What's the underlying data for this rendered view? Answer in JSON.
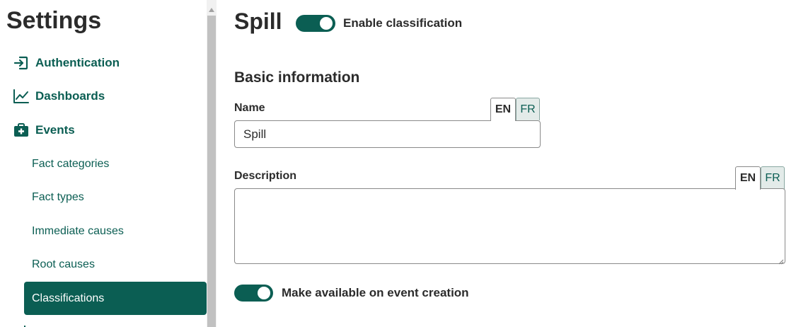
{
  "sidebar": {
    "title": "Settings",
    "main_items": [
      {
        "label": "Authentication",
        "icon": "sign-in-icon"
      },
      {
        "label": "Dashboards",
        "icon": "line-chart-icon"
      },
      {
        "label": "Events",
        "icon": "medkit-icon"
      }
    ],
    "sub_items": [
      {
        "label": "Fact categories"
      },
      {
        "label": "Fact types"
      },
      {
        "label": "Immediate causes"
      },
      {
        "label": "Root causes"
      }
    ],
    "active_item": {
      "label": "Classifications"
    }
  },
  "main": {
    "title": "Spill",
    "enable_toggle": {
      "label": "Enable classification",
      "on": true
    },
    "section_title": "Basic information",
    "name_field": {
      "label": "Name",
      "value": "Spill",
      "lang_tabs": [
        "EN",
        "FR"
      ],
      "active_lang": "EN"
    },
    "description_field": {
      "label": "Description",
      "value": "",
      "lang_tabs": [
        "EN",
        "FR"
      ],
      "active_lang": "EN"
    },
    "event_creation_toggle": {
      "label": "Make available on event creation",
      "on": true
    }
  },
  "colors": {
    "accent": "#0b5e53",
    "inactive_tab_bg": "#e3ebe9",
    "scrollbar_thumb": "#c1c1c1",
    "text": "#2b2b2b"
  }
}
